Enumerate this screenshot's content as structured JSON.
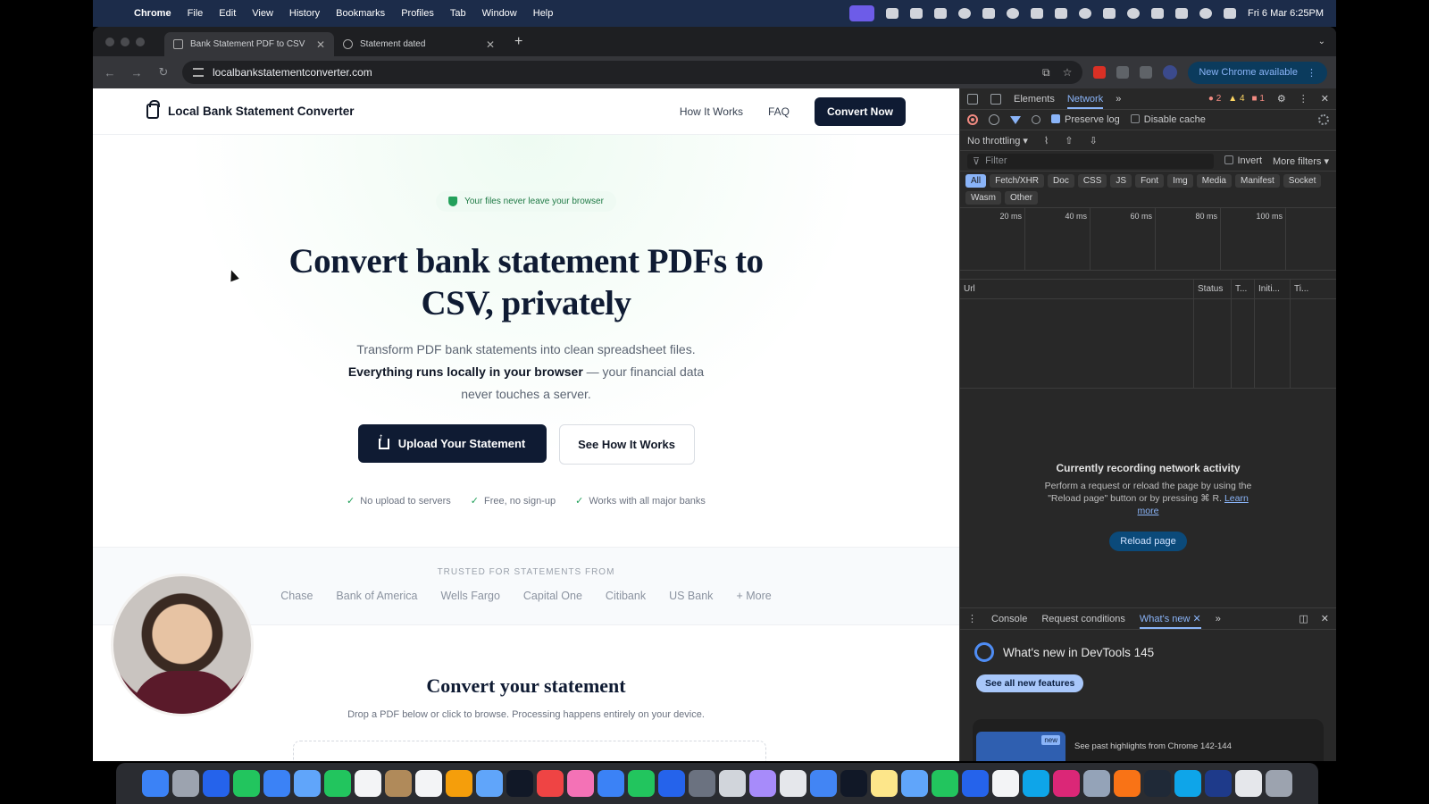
{
  "menubar": {
    "app": "Chrome",
    "items": [
      "File",
      "Edit",
      "View",
      "History",
      "Bookmarks",
      "Profiles",
      "Tab",
      "Window",
      "Help"
    ],
    "clock": "Fri 6 Mar  6:25PM"
  },
  "browser": {
    "tabs": [
      {
        "title": "Bank Statement PDF to CSV"
      },
      {
        "title": "Statement  dated"
      }
    ],
    "url": "localbankstatementconverter.com",
    "update_label": "New Chrome available"
  },
  "site": {
    "brand": "Local Bank Statement Converter",
    "nav": {
      "how_it_works": "How It Works",
      "faq": "FAQ",
      "convert_now": "Convert Now"
    },
    "hero": {
      "badge": "Your files never leave your browser",
      "title_line1": "Convert bank statement PDFs to",
      "title_line2": "CSV, privately",
      "lead_line1": "Transform PDF bank statements into clean spreadsheet files.",
      "lead_bold": "Everything runs locally in your browser",
      "lead_rest": " — your financial data",
      "lead_line3": "never touches a server.",
      "upload_label": "Upload Your Statement",
      "see_how_label": "See How It Works",
      "checks": [
        "No upload to servers",
        "Free, no sign-up",
        "Works with all major banks"
      ]
    },
    "trusted": {
      "label": "TRUSTED FOR STATEMENTS FROM",
      "banks": [
        "Chase",
        "Bank of America",
        "Wells Fargo",
        "Capital One",
        "Citibank",
        "US Bank",
        "+ More"
      ]
    },
    "convert": {
      "title": "Convert your statement",
      "subtitle": "Drop a PDF below or click to browse. Processing happens entirely on your device."
    }
  },
  "devtools": {
    "tabs": {
      "elements": "Elements",
      "network": "Network",
      "more": "»"
    },
    "errors": "2",
    "warnings": "4",
    "issues": "1",
    "preserve_log": "Preserve log",
    "disable_cache": "Disable cache",
    "throttling": "No throttling",
    "filter_placeholder": "Filter",
    "invert": "Invert",
    "more_filters": "More filters",
    "chips": [
      "All",
      "Fetch/XHR",
      "Doc",
      "CSS",
      "JS",
      "Font",
      "Img",
      "Media",
      "Manifest",
      "Socket",
      "Wasm",
      "Other"
    ],
    "timeline_ticks": [
      "20 ms",
      "40 ms",
      "60 ms",
      "80 ms",
      "100 ms"
    ],
    "columns": [
      "Url",
      "Status",
      "T...",
      "Initi...",
      "Ti..."
    ],
    "recording_title": "Currently recording network activity",
    "recording_desc": "Perform a request or reload the page by using the \"Reload page\" button or by pressing ⌘ R.",
    "learn_more": "Learn more",
    "reload_label": "Reload page",
    "drawer_tabs": [
      "Console",
      "Request conditions",
      "What's new"
    ],
    "whats_new_title": "What's new in DevTools 145",
    "see_all": "See all new features",
    "highlight_new": "new",
    "highlight_text": "See past highlights from Chrome 142-144"
  },
  "dock": {
    "icon_colors": [
      "#3b82f6",
      "#9ca3af",
      "#2563eb",
      "#22c55e",
      "#3b82f6",
      "#60a5fa",
      "#22c55e",
      "#f3f4f6",
      "#b08a5a",
      "#f3f4f6",
      "#f59e0b",
      "#60a5fa",
      "#111827",
      "#ef4444",
      "#f472b6",
      "#3b82f6",
      "#22c55e",
      "#2563eb",
      "#6b7280",
      "#d1d5db",
      "#a78bfa",
      "#e5e7eb",
      "#4285f4",
      "#111827",
      "#fde68a",
      "#60a5fa",
      "#22c55e",
      "#2563eb",
      "#f3f4f6",
      "#0ea5e9",
      "#db2777",
      "#94a3b8",
      "#f97316",
      "#1f2937",
      "#0ea5e9",
      "#1e3a8a",
      "#e5e7eb",
      "#9ca3af"
    ]
  }
}
